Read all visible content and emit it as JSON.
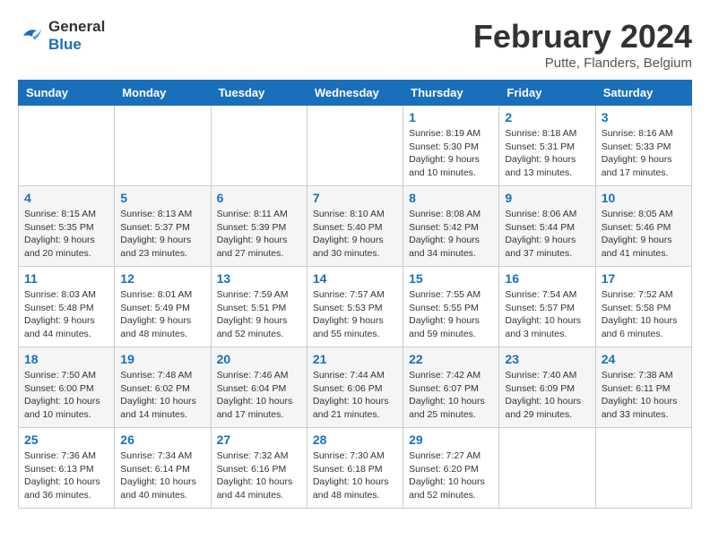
{
  "header": {
    "logo_line1": "General",
    "logo_line2": "Blue",
    "month": "February 2024",
    "location": "Putte, Flanders, Belgium"
  },
  "weekdays": [
    "Sunday",
    "Monday",
    "Tuesday",
    "Wednesday",
    "Thursday",
    "Friday",
    "Saturday"
  ],
  "weeks": [
    [
      {
        "day": "",
        "info": ""
      },
      {
        "day": "",
        "info": ""
      },
      {
        "day": "",
        "info": ""
      },
      {
        "day": "",
        "info": ""
      },
      {
        "day": "1",
        "info": "Sunrise: 8:19 AM\nSunset: 5:30 PM\nDaylight: 9 hours\nand 10 minutes."
      },
      {
        "day": "2",
        "info": "Sunrise: 8:18 AM\nSunset: 5:31 PM\nDaylight: 9 hours\nand 13 minutes."
      },
      {
        "day": "3",
        "info": "Sunrise: 8:16 AM\nSunset: 5:33 PM\nDaylight: 9 hours\nand 17 minutes."
      }
    ],
    [
      {
        "day": "4",
        "info": "Sunrise: 8:15 AM\nSunset: 5:35 PM\nDaylight: 9 hours\nand 20 minutes."
      },
      {
        "day": "5",
        "info": "Sunrise: 8:13 AM\nSunset: 5:37 PM\nDaylight: 9 hours\nand 23 minutes."
      },
      {
        "day": "6",
        "info": "Sunrise: 8:11 AM\nSunset: 5:39 PM\nDaylight: 9 hours\nand 27 minutes."
      },
      {
        "day": "7",
        "info": "Sunrise: 8:10 AM\nSunset: 5:40 PM\nDaylight: 9 hours\nand 30 minutes."
      },
      {
        "day": "8",
        "info": "Sunrise: 8:08 AM\nSunset: 5:42 PM\nDaylight: 9 hours\nand 34 minutes."
      },
      {
        "day": "9",
        "info": "Sunrise: 8:06 AM\nSunset: 5:44 PM\nDaylight: 9 hours\nand 37 minutes."
      },
      {
        "day": "10",
        "info": "Sunrise: 8:05 AM\nSunset: 5:46 PM\nDaylight: 9 hours\nand 41 minutes."
      }
    ],
    [
      {
        "day": "11",
        "info": "Sunrise: 8:03 AM\nSunset: 5:48 PM\nDaylight: 9 hours\nand 44 minutes."
      },
      {
        "day": "12",
        "info": "Sunrise: 8:01 AM\nSunset: 5:49 PM\nDaylight: 9 hours\nand 48 minutes."
      },
      {
        "day": "13",
        "info": "Sunrise: 7:59 AM\nSunset: 5:51 PM\nDaylight: 9 hours\nand 52 minutes."
      },
      {
        "day": "14",
        "info": "Sunrise: 7:57 AM\nSunset: 5:53 PM\nDaylight: 9 hours\nand 55 minutes."
      },
      {
        "day": "15",
        "info": "Sunrise: 7:55 AM\nSunset: 5:55 PM\nDaylight: 9 hours\nand 59 minutes."
      },
      {
        "day": "16",
        "info": "Sunrise: 7:54 AM\nSunset: 5:57 PM\nDaylight: 10 hours\nand 3 minutes."
      },
      {
        "day": "17",
        "info": "Sunrise: 7:52 AM\nSunset: 5:58 PM\nDaylight: 10 hours\nand 6 minutes."
      }
    ],
    [
      {
        "day": "18",
        "info": "Sunrise: 7:50 AM\nSunset: 6:00 PM\nDaylight: 10 hours\nand 10 minutes."
      },
      {
        "day": "19",
        "info": "Sunrise: 7:48 AM\nSunset: 6:02 PM\nDaylight: 10 hours\nand 14 minutes."
      },
      {
        "day": "20",
        "info": "Sunrise: 7:46 AM\nSunset: 6:04 PM\nDaylight: 10 hours\nand 17 minutes."
      },
      {
        "day": "21",
        "info": "Sunrise: 7:44 AM\nSunset: 6:06 PM\nDaylight: 10 hours\nand 21 minutes."
      },
      {
        "day": "22",
        "info": "Sunrise: 7:42 AM\nSunset: 6:07 PM\nDaylight: 10 hours\nand 25 minutes."
      },
      {
        "day": "23",
        "info": "Sunrise: 7:40 AM\nSunset: 6:09 PM\nDaylight: 10 hours\nand 29 minutes."
      },
      {
        "day": "24",
        "info": "Sunrise: 7:38 AM\nSunset: 6:11 PM\nDaylight: 10 hours\nand 33 minutes."
      }
    ],
    [
      {
        "day": "25",
        "info": "Sunrise: 7:36 AM\nSunset: 6:13 PM\nDaylight: 10 hours\nand 36 minutes."
      },
      {
        "day": "26",
        "info": "Sunrise: 7:34 AM\nSunset: 6:14 PM\nDaylight: 10 hours\nand 40 minutes."
      },
      {
        "day": "27",
        "info": "Sunrise: 7:32 AM\nSunset: 6:16 PM\nDaylight: 10 hours\nand 44 minutes."
      },
      {
        "day": "28",
        "info": "Sunrise: 7:30 AM\nSunset: 6:18 PM\nDaylight: 10 hours\nand 48 minutes."
      },
      {
        "day": "29",
        "info": "Sunrise: 7:27 AM\nSunset: 6:20 PM\nDaylight: 10 hours\nand 52 minutes."
      },
      {
        "day": "",
        "info": ""
      },
      {
        "day": "",
        "info": ""
      }
    ]
  ]
}
